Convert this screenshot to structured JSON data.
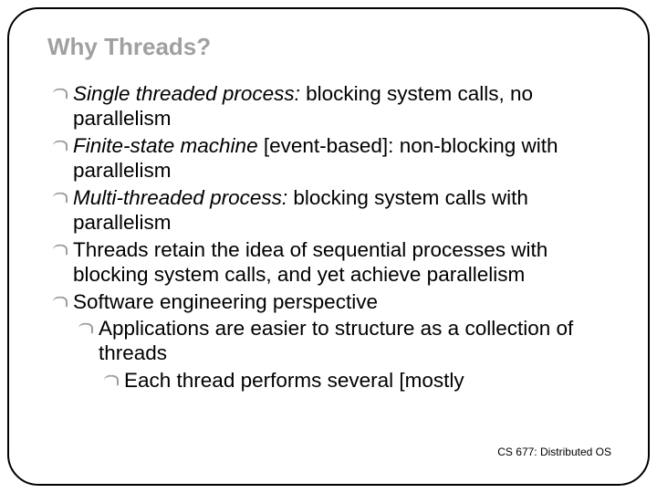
{
  "title": "Why Threads?",
  "b1_em": "Single threaded process:",
  "b1_rest": " blocking system calls, no parallelism",
  "b2_em": "Finite-state machine",
  "b2_rest": " [event-based]: non-blocking with parallelism",
  "b3_em": "Multi-threaded process:",
  "b3_rest": " blocking system calls with parallelism",
  "b4": "Threads retain the idea of sequential processes with blocking system calls, and yet achieve parallelism",
  "b5": "Software engineering perspective",
  "b5a": "Applications are easier to structure as a collection of threads",
  "b5b": "Each thread performs several [mostly",
  "footer": "CS 677: Distributed OS"
}
